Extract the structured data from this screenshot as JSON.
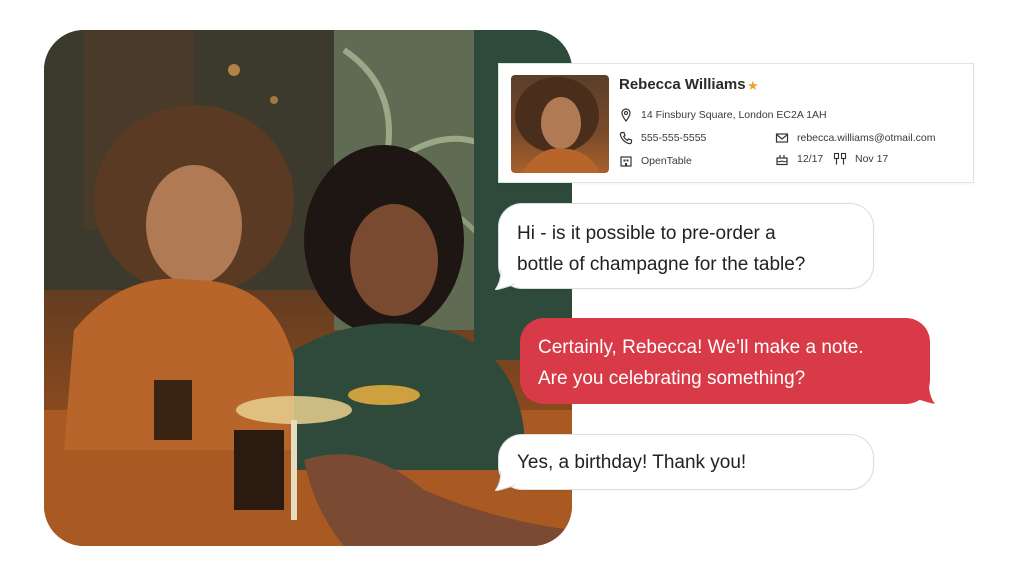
{
  "contact": {
    "name": "Rebecca Williams",
    "address": "14 Finsbury Square, London EC2A 1AH",
    "phone": "555-555-5555",
    "email": "rebecca.williams@otmail.com",
    "source": "OpenTable",
    "birthday": "12/17",
    "visit": "Nov 17",
    "icons": [
      "star-icon",
      "location-pin-icon",
      "phone-icon",
      "email-icon",
      "building-icon",
      "cake-icon",
      "dining-icon"
    ],
    "accent_star": "#f0a030"
  },
  "messages": [
    {
      "from": "guest",
      "lines": [
        "Hi - is it possible to pre-order a",
        "bottle of champagne for the table?"
      ]
    },
    {
      "from": "restaurant",
      "lines": [
        "Certainly, Rebecca! We’ll make a note.",
        "Are you celebrating something?"
      ]
    },
    {
      "from": "guest",
      "lines": [
        "Yes, a birthday! Thank you!"
      ]
    }
  ],
  "colors": {
    "outgoing_bubble": "#d93a48",
    "incoming_bubble": "#ffffff",
    "card_border": "#d5ead7"
  }
}
